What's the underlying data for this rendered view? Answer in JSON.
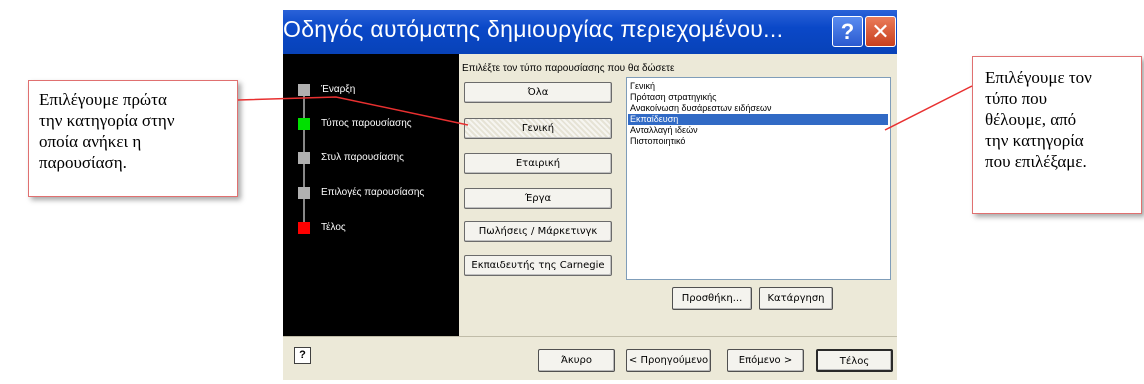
{
  "dialog": {
    "title": "Οδηγός αυτόματης δημιουργίας περιεχομένου...",
    "help_button": "?",
    "close_button": "✕"
  },
  "steps": [
    {
      "label": "Έναρξη",
      "color": "#b0b0b0"
    },
    {
      "label": "Τύπος παρουσίασης",
      "color": "#00e000"
    },
    {
      "label": "Στυλ παρουσίασης",
      "color": "#b0b0b0"
    },
    {
      "label": "Επιλογές παρουσίασης",
      "color": "#b0b0b0"
    },
    {
      "label": "Τέλος",
      "color": "#ff0000"
    }
  ],
  "prompt": "Επιλέξτε τον τύπο παρουσίασης που θα δώσετε",
  "categories": [
    {
      "label": "Όλα",
      "active": false
    },
    {
      "label": "Γενική",
      "active": true
    },
    {
      "label": "Εταιρική",
      "active": false
    },
    {
      "label": "Έργα",
      "active": false
    },
    {
      "label": "Πωλήσεις / Μάρκετινγκ",
      "active": false
    },
    {
      "label": "Εκπαιδευτής της Carnegie",
      "active": false
    }
  ],
  "presentations": [
    {
      "label": "Γενική",
      "selected": false
    },
    {
      "label": "Πρόταση στρατηγικής",
      "selected": false
    },
    {
      "label": "Ανακοίνωση δυσάρεστων ειδήσεων",
      "selected": false
    },
    {
      "label": "Εκπαίδευση",
      "selected": true
    },
    {
      "label": "Ανταλλαγή ιδεών",
      "selected": false
    },
    {
      "label": "Πιστοποιητικό",
      "selected": false
    }
  ],
  "list_buttons": {
    "add": "Προσθήκη...",
    "remove": "Κατάργηση"
  },
  "footer": {
    "help_icon": "?",
    "cancel": "Άκυρο",
    "back": "< Προηγούμενο",
    "next": "Επόμενο >",
    "finish": "Τέλος"
  },
  "annotations": {
    "left_lines": [
      "Επιλέγουμε πρώτα",
      "την κατηγορία στην",
      "οποία ανήκει η",
      "παρουσίαση."
    ],
    "right_lines": [
      "Επιλέγουμε τον",
      "τύπο που",
      "θέλουμε, από",
      "την κατηγορία",
      "που επιλέξαμε."
    ]
  },
  "colors": {
    "title_bar": "#0a48c8",
    "selection": "#316ac5",
    "annotation_line": "#e83030"
  }
}
